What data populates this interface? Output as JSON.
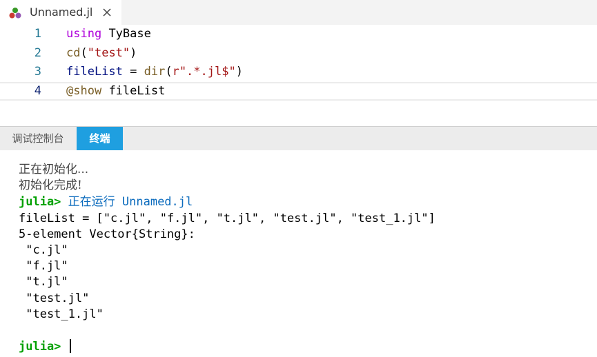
{
  "tab": {
    "title": "Unnamed.jl",
    "icon": "julia-icon",
    "close_icon": "close-icon"
  },
  "editor": {
    "lines": [
      {
        "number": "1",
        "tokens": [
          {
            "text": "using",
            "kind": "kw"
          },
          {
            "text": " ",
            "kind": "plain"
          },
          {
            "text": "TyBase",
            "kind": "plain"
          }
        ]
      },
      {
        "number": "2",
        "tokens": [
          {
            "text": "cd",
            "kind": "fn"
          },
          {
            "text": "(",
            "kind": "op"
          },
          {
            "text": "\"test\"",
            "kind": "str"
          },
          {
            "text": ")",
            "kind": "op"
          }
        ]
      },
      {
        "number": "3",
        "tokens": [
          {
            "text": "fileList",
            "kind": "var"
          },
          {
            "text": " = ",
            "kind": "op"
          },
          {
            "text": "dir",
            "kind": "fn"
          },
          {
            "text": "(",
            "kind": "op"
          },
          {
            "text": "r\".*.jl$\"",
            "kind": "str"
          },
          {
            "text": ")",
            "kind": "op"
          }
        ]
      },
      {
        "number": "4",
        "tokens": [
          {
            "text": "@show",
            "kind": "fn"
          },
          {
            "text": " ",
            "kind": "plain"
          },
          {
            "text": "fileList",
            "kind": "var"
          }
        ]
      }
    ],
    "current_line": 4
  },
  "panel": {
    "tabs": [
      {
        "label": "调试控制台",
        "active": false
      },
      {
        "label": "终端",
        "active": true
      }
    ]
  },
  "terminal": {
    "init_line": "正在初始化...",
    "init_done": "初始化完成!",
    "prompt": "julia>",
    "running_text": " 正在运行 Unnamed.jl",
    "output_lines": [
      "fileList = [\"c.jl\", \"f.jl\", \"t.jl\", \"test.jl\", \"test_1.jl\"]",
      "5-element Vector{String}:",
      " \"c.jl\"",
      " \"f.jl\"",
      " \"t.jl\"",
      " \"test.jl\"",
      " \"test_1.jl\""
    ],
    "final_prompt": "julia>"
  },
  "colors": {
    "tab_active_bg": "#1f9fe0",
    "prompt_green": "#00a000",
    "keyword_purple": "#af00db",
    "string_red": "#a31515"
  }
}
